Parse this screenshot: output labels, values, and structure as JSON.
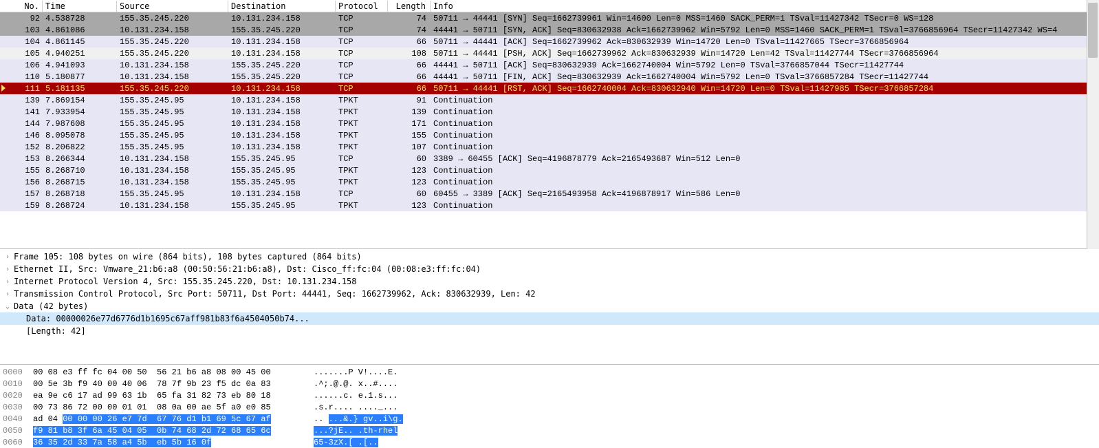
{
  "columns": {
    "no": "No.",
    "time": "Time",
    "src": "Source",
    "dst": "Destination",
    "proto": "Protocol",
    "len": "Length",
    "info": "Info"
  },
  "packets": [
    {
      "no": "92",
      "time": "4.538728",
      "src": "155.35.245.220",
      "dst": "10.131.234.158",
      "proto": "TCP",
      "len": "74",
      "info": "50711 → 44441 [SYN] Seq=1662739961 Win=14600 Len=0 MSS=1460 SACK_PERM=1 TSval=11427342 TSecr=0 WS=128",
      "style": "grey"
    },
    {
      "no": "103",
      "time": "4.861086",
      "src": "10.131.234.158",
      "dst": "155.35.245.220",
      "proto": "TCP",
      "len": "74",
      "info": "44441 → 50711 [SYN, ACK] Seq=830632938 Ack=1662739962 Win=5792 Len=0 MSS=1460 SACK_PERM=1 TSval=3766856964 TSecr=11427342 WS=4",
      "style": "grey"
    },
    {
      "no": "104",
      "time": "4.861145",
      "src": "155.35.245.220",
      "dst": "10.131.234.158",
      "proto": "TCP",
      "len": "66",
      "info": "50711 → 44441 [ACK] Seq=1662739962 Ack=830632939 Win=14720 Len=0 TSval=11427665 TSecr=3766856964",
      "style": "lav"
    },
    {
      "no": "105",
      "time": "4.940251",
      "src": "155.35.245.220",
      "dst": "10.131.234.158",
      "proto": "TCP",
      "len": "108",
      "info": "50711 → 44441 [PSH, ACK] Seq=1662739962 Ack=830632939 Win=14720 Len=42 TSval=11427744 TSecr=3766856964",
      "style": "ltgr"
    },
    {
      "no": "106",
      "time": "4.941093",
      "src": "10.131.234.158",
      "dst": "155.35.245.220",
      "proto": "TCP",
      "len": "66",
      "info": "44441 → 50711 [ACK] Seq=830632939 Ack=1662740004 Win=5792 Len=0 TSval=3766857044 TSecr=11427744",
      "style": "lav"
    },
    {
      "no": "110",
      "time": "5.180877",
      "src": "10.131.234.158",
      "dst": "155.35.245.220",
      "proto": "TCP",
      "len": "66",
      "info": "44441 → 50711 [FIN, ACK] Seq=830632939 Ack=1662740004 Win=5792 Len=0 TSval=3766857284 TSecr=11427744",
      "style": "lav"
    },
    {
      "no": "111",
      "time": "5.181135",
      "src": "155.35.245.220",
      "dst": "10.131.234.158",
      "proto": "TCP",
      "len": "66",
      "info": "50711 → 44441 [RST, ACK] Seq=1662740004 Ack=830632940 Win=14720 Len=0 TSval=11427985 TSecr=3766857284",
      "style": "red",
      "expert": true
    },
    {
      "no": "139",
      "time": "7.869154",
      "src": "155.35.245.95",
      "dst": "10.131.234.158",
      "proto": "TPKT",
      "len": "91",
      "info": "Continuation",
      "style": "lav"
    },
    {
      "no": "141",
      "time": "7.933954",
      "src": "155.35.245.95",
      "dst": "10.131.234.158",
      "proto": "TPKT",
      "len": "139",
      "info": "Continuation",
      "style": "lav"
    },
    {
      "no": "144",
      "time": "7.987608",
      "src": "155.35.245.95",
      "dst": "10.131.234.158",
      "proto": "TPKT",
      "len": "171",
      "info": "Continuation",
      "style": "lav"
    },
    {
      "no": "146",
      "time": "8.095078",
      "src": "155.35.245.95",
      "dst": "10.131.234.158",
      "proto": "TPKT",
      "len": "155",
      "info": "Continuation",
      "style": "lav"
    },
    {
      "no": "152",
      "time": "8.206822",
      "src": "155.35.245.95",
      "dst": "10.131.234.158",
      "proto": "TPKT",
      "len": "107",
      "info": "Continuation",
      "style": "lav"
    },
    {
      "no": "153",
      "time": "8.266344",
      "src": "10.131.234.158",
      "dst": "155.35.245.95",
      "proto": "TCP",
      "len": "60",
      "info": "3389 → 60455 [ACK] Seq=4196878779 Ack=2165493687 Win=512 Len=0",
      "style": "lav"
    },
    {
      "no": "155",
      "time": "8.268710",
      "src": "10.131.234.158",
      "dst": "155.35.245.95",
      "proto": "TPKT",
      "len": "123",
      "info": "Continuation",
      "style": "lav"
    },
    {
      "no": "156",
      "time": "8.268715",
      "src": "10.131.234.158",
      "dst": "155.35.245.95",
      "proto": "TPKT",
      "len": "123",
      "info": "Continuation",
      "style": "lav"
    },
    {
      "no": "157",
      "time": "8.268718",
      "src": "155.35.245.95",
      "dst": "10.131.234.158",
      "proto": "TCP",
      "len": "60",
      "info": "60455 → 3389 [ACK] Seq=2165493958 Ack=4196878917 Win=586 Len=0",
      "style": "lav"
    },
    {
      "no": "159",
      "time": "8.268724",
      "src": "10.131.234.158",
      "dst": "155.35.245.95",
      "proto": "TPKT",
      "len": "123",
      "info": "Continuation",
      "style": "lav"
    }
  ],
  "details": {
    "frame": "Frame 105: 108 bytes on wire (864 bits), 108 bytes captured (864 bits)",
    "eth": "Ethernet II, Src: Vmware_21:b6:a8 (00:50:56:21:b6:a8), Dst: Cisco_ff:fc:04 (00:08:e3:ff:fc:04)",
    "ip": "Internet Protocol Version 4, Src: 155.35.245.220, Dst: 10.131.234.158",
    "tcp": "Transmission Control Protocol, Src Port: 50711, Dst Port: 44441, Seq: 1662739962, Ack: 830632939, Len: 42",
    "dataH": "Data (42 bytes)",
    "data": "Data: 00000026e77d6776d1b1695c67aff981b83f6a4504050b74...",
    "dlen": "[Length: 42]"
  },
  "hex": [
    {
      "off": "0000",
      "h1": "00 08 e3 ff fc 04 00 50",
      "h2": "56 21 b6 a8 08 00 45 00",
      "a": ".......P V!....E."
    },
    {
      "off": "0010",
      "h1": "00 5e 3b f9 40 00 40 06",
      "h2": "78 7f 9b 23 f5 dc 0a 83",
      "a": ".^;.@.@. x..#...."
    },
    {
      "off": "0020",
      "h1": "ea 9e c6 17 ad 99 63 1b",
      "h2": "65 fa 31 82 73 eb 80 18",
      "a": "......c. e.1.s..."
    },
    {
      "off": "0030",
      "h1": "00 73 86 72 00 00 01 01",
      "h2": "08 0a 00 ae 5f a0 e0 85",
      "a": ".s.r.... ...._..."
    },
    {
      "off": "0040",
      "pre": "ad 04 ",
      "h1": "00 00 00 26 e7 7d",
      "h2": "67 76 d1 b1 69 5c 67 af",
      "apre": ".. ",
      "a": "...&.} gv..i\\g.",
      "sel": true
    },
    {
      "off": "0050",
      "h1": "f9 81 b8 3f 6a 45 04 05",
      "h2": "0b 74 68 2d 72 68 65 6c",
      "a": "...?jE.. .th-rhel",
      "sel": true
    },
    {
      "off": "0060",
      "h1": "36 35 2d 33 7a 58 a4 5b",
      "h2": "eb 5b 16 0f",
      "a": "65-3zX.[ .[..",
      "sel": true
    }
  ]
}
